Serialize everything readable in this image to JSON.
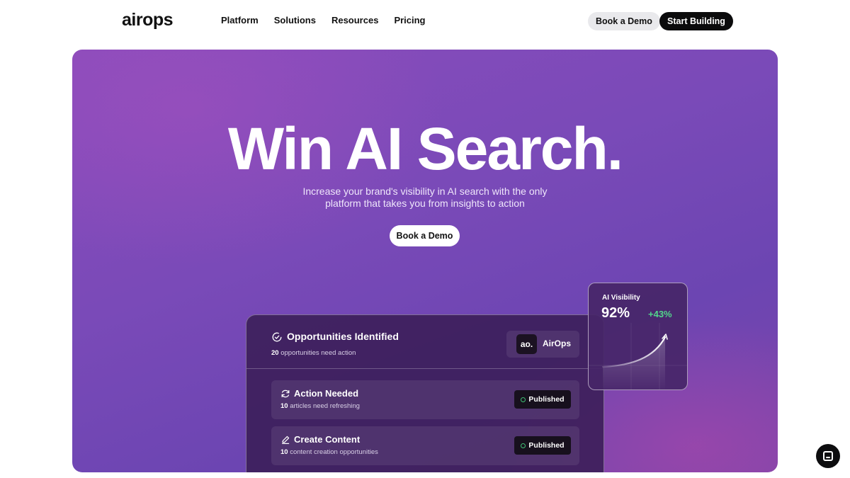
{
  "header": {
    "logo": "airops",
    "nav": [
      "Platform",
      "Solutions",
      "Resources",
      "Pricing"
    ],
    "book_demo": "Book a Demo",
    "start_building": "Start Building"
  },
  "hero": {
    "headline": "Win AI Search.",
    "subline_1": "Increase your brand's visibility in AI search with the only",
    "subline_2": "platform that takes you from insights to action",
    "cta": "Book a Demo"
  },
  "dashboard": {
    "title": "Opportunities Identified",
    "count": "20",
    "count_label": "opportunities need action",
    "brand_mark": "ao.",
    "brand_name": "AirOps",
    "rows": [
      {
        "icon": "refresh-icon",
        "title": "Action Needed",
        "count": "10",
        "label": "articles need refreshing",
        "badge": "Published"
      },
      {
        "icon": "edit-icon",
        "title": "Create Content",
        "count": "10",
        "label": "content creation opportunities",
        "badge": "Published"
      }
    ]
  },
  "visibility": {
    "label": "AI Visibility",
    "value": "92%",
    "delta": "+43%"
  },
  "colors": {
    "hero_gradient_start": "#8a4cbc",
    "hero_gradient_end": "#6c45b2",
    "positive": "#52d68b",
    "cta_dark": "#0b0b0c"
  }
}
